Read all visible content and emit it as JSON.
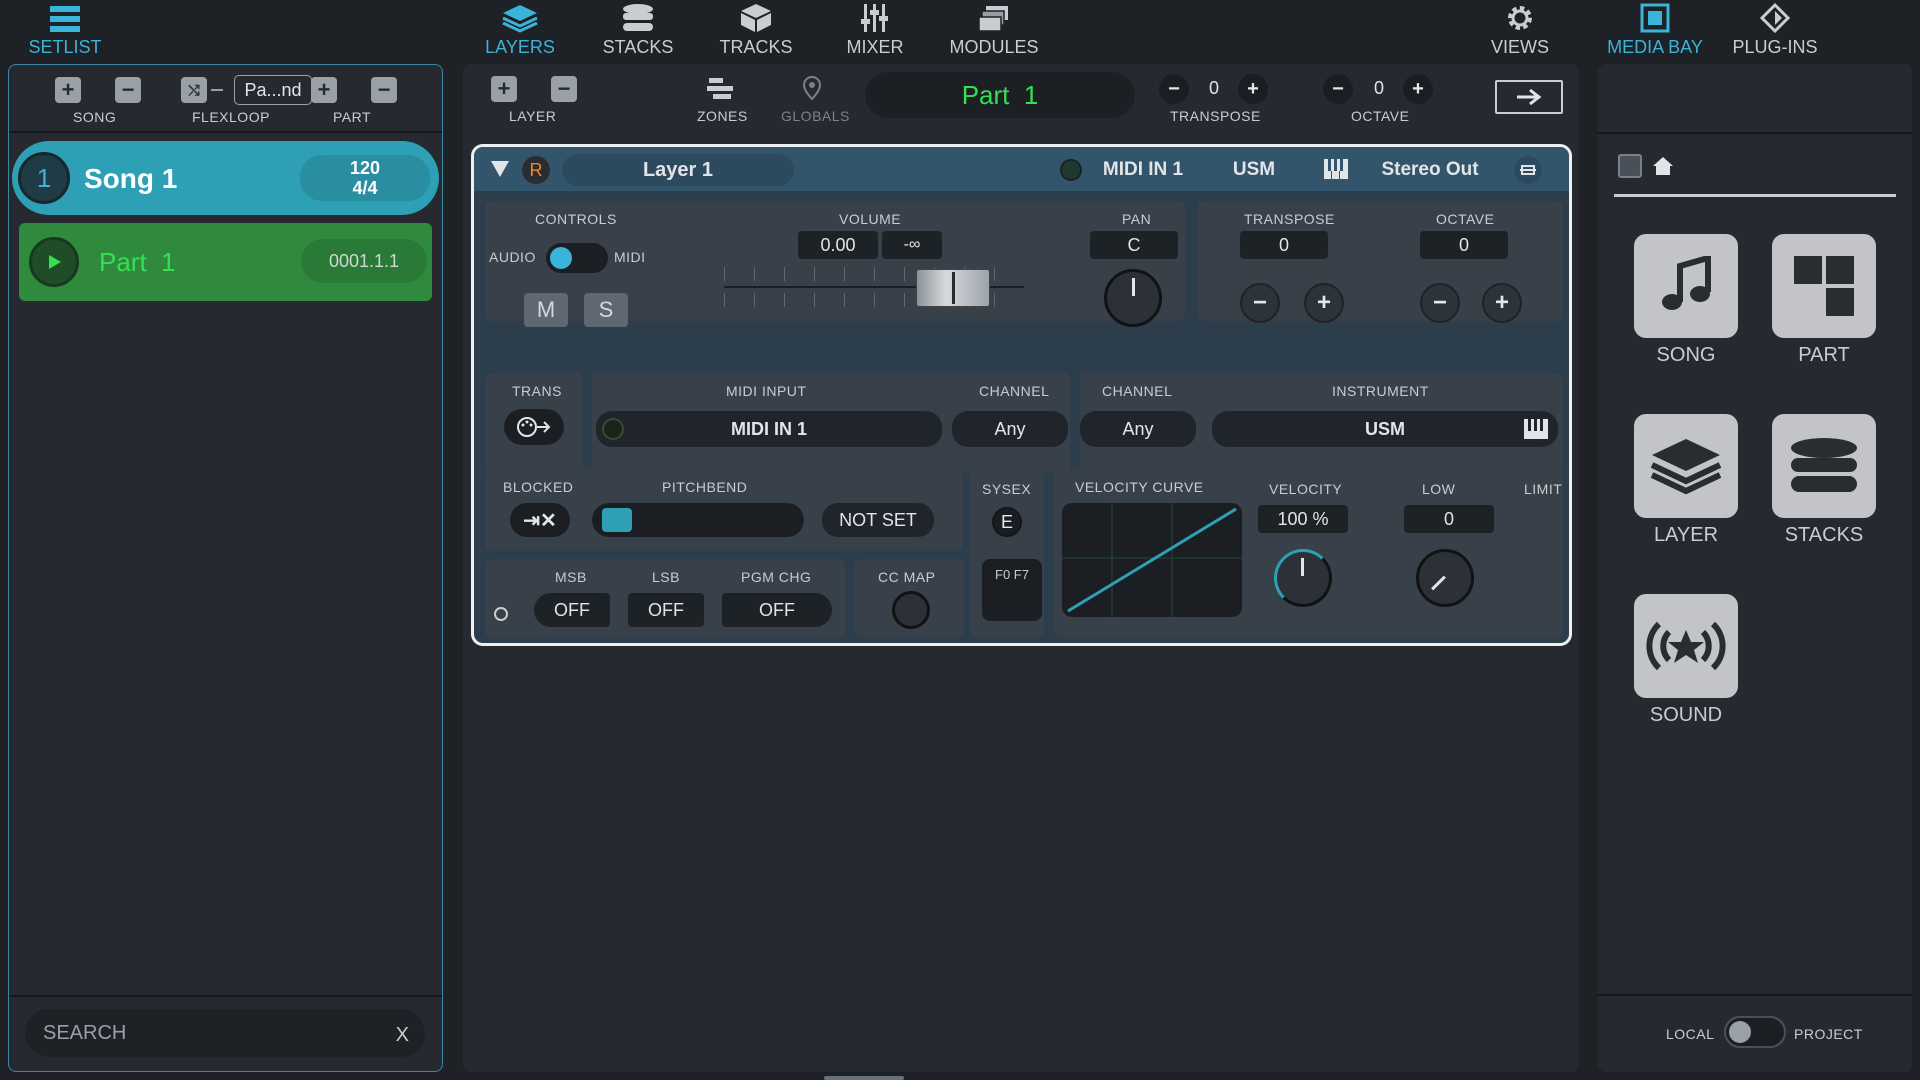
{
  "left_tabs": {
    "setlist": "SETLIST"
  },
  "center_tabs": {
    "layers": "LAYERS",
    "stacks": "STACKS",
    "tracks": "TRACKS",
    "mixer": "MIXER",
    "modules": "MODULES",
    "views": "VIEWS"
  },
  "right_tabs": {
    "media_bay": "MEDIA BAY",
    "plug_ins": "PLUG-INS"
  },
  "setlist": {
    "toolbar": {
      "song": "SONG",
      "flexloop": "FLEXLOOP",
      "part": "PART",
      "flexloop_field": "Pa...nd"
    },
    "song": {
      "number": "1",
      "name": "Song 1",
      "tempo": "120",
      "signature": "4/4"
    },
    "part": {
      "name": "Part  1",
      "position": "0001.1.1"
    },
    "search": {
      "placeholder": "SEARCH",
      "clear": "X"
    }
  },
  "layers_toolbar": {
    "layer": "LAYER",
    "zones": "ZONES",
    "globals": "GLOBALS",
    "part_display": "Part  1",
    "transpose": {
      "label": "TRANSPOSE",
      "value": "0"
    },
    "octave": {
      "label": "OCTAVE",
      "value": "0"
    }
  },
  "layer": {
    "record_badge": "R",
    "name": "Layer 1",
    "midi_in": "MIDI IN 1",
    "instrument": "USM",
    "output": "Stereo Out",
    "controls": {
      "label": "CONTROLS",
      "audio": "AUDIO",
      "midi": "MIDI",
      "mute": "M",
      "solo": "S"
    },
    "volume": {
      "label": "VOLUME",
      "value": "0.00",
      "peak": "-∞"
    },
    "pan": {
      "label": "PAN",
      "value": "C"
    },
    "transpose": {
      "label": "TRANSPOSE",
      "value": "0"
    },
    "octave": {
      "label": "OCTAVE",
      "value": "0"
    },
    "trans": {
      "label": "TRANS"
    },
    "midi_input": {
      "label": "MIDI INPUT",
      "value": "MIDI IN 1"
    },
    "channel_in": {
      "label": "CHANNEL",
      "value": "Any"
    },
    "channel_out": {
      "label": "CHANNEL",
      "value": "Any"
    },
    "instrument_sel": {
      "label": "INSTRUMENT",
      "value": "USM"
    },
    "blocked": {
      "label": "BLOCKED"
    },
    "pitchbend": {
      "label": "PITCHBEND",
      "value": "NOT SET"
    },
    "sysex": {
      "label": "SYSEX",
      "button": "E",
      "bytes": "F0 F7"
    },
    "velocity_curve": {
      "label": "VELOCITY CURVE"
    },
    "velocity": {
      "label": "VELOCITY",
      "value": "100 %"
    },
    "low": {
      "label": "LOW",
      "value": "0"
    },
    "limit": {
      "label": "LIMIT"
    },
    "msb": {
      "label": "MSB",
      "value": "OFF"
    },
    "lsb": {
      "label": "LSB",
      "value": "OFF"
    },
    "pgm_chg": {
      "label": "PGM CHG",
      "value": "OFF"
    },
    "cc_map": {
      "label": "CC MAP"
    }
  },
  "media_bay": {
    "tiles": {
      "song": "SONG",
      "part": "PART",
      "layer": "LAYER",
      "stacks": "STACKS",
      "sound": "SOUND"
    },
    "local": "LOCAL",
    "project": "PROJECT"
  },
  "colors": {
    "accent": "#3ab4d8",
    "song_row": "#2ea0b5",
    "part_row": "#2f8a3e",
    "part_text": "#33e052"
  }
}
